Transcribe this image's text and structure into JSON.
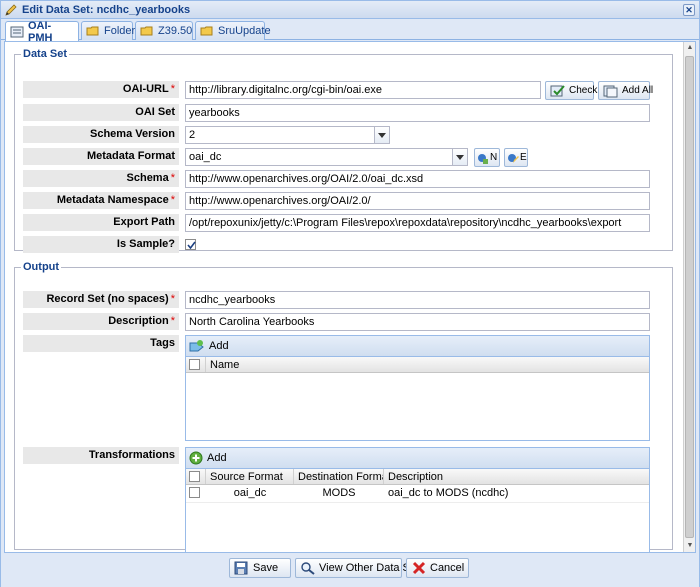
{
  "window": {
    "title": "Edit Data Set: ncdhc_yearbooks"
  },
  "tabs": [
    {
      "label": "OAI-PMH"
    },
    {
      "label": "Folder"
    },
    {
      "label": "Z39.50"
    },
    {
      "label": "SruUpdate"
    }
  ],
  "dataset": {
    "legend": "Data Set",
    "oai_url": {
      "label": "OAI-URL",
      "value": "http://library.digitalnc.org/cgi-bin/oai.exe"
    },
    "check_label": "Check",
    "add_all_label": "Add All",
    "oai_set": {
      "label": "OAI Set",
      "value": "yearbooks"
    },
    "schema_version": {
      "label": "Schema Version",
      "value": "2"
    },
    "metadata_format": {
      "label": "Metadata Format",
      "value": "oai_dc"
    },
    "new_btn_label": "N",
    "edit_btn_label": "E",
    "schema": {
      "label": "Schema",
      "value": "http://www.openarchives.org/OAI/2.0/oai_dc.xsd"
    },
    "metadata_namespace": {
      "label": "Metadata Namespace",
      "value": "http://www.openarchives.org/OAI/2.0/"
    },
    "export_path": {
      "label": "Export Path",
      "value": "/opt/repoxunix/jetty/c:\\Program Files\\repox\\repoxdata\\repository\\ncdhc_yearbooks\\export"
    },
    "is_sample": {
      "label": "Is Sample?",
      "checked": true
    }
  },
  "output": {
    "legend": "Output",
    "record_set": {
      "label": "Record Set (no spaces)",
      "value": "ncdhc_yearbooks"
    },
    "description": {
      "label": "Description",
      "value": "North Carolina Yearbooks"
    },
    "tags": {
      "label": "Tags",
      "add_label": "Add",
      "columns": [
        "Name"
      ]
    },
    "transformations": {
      "label": "Transformations",
      "add_label": "Add",
      "columns": [
        "Source Format",
        "Destination Format",
        "Description"
      ],
      "rows": [
        {
          "source": "oai_dc",
          "destination": "MODS",
          "description": "oai_dc to MODS (ncdhc)"
        }
      ]
    }
  },
  "footer": {
    "save_label": "Save",
    "view_other_label": "View Other Data Set",
    "cancel_label": "Cancel"
  },
  "colors": {
    "title_text": "#15428b",
    "panel_bg": "#dfe8f6",
    "border": "#99bbe8",
    "required": "#dd0000"
  }
}
